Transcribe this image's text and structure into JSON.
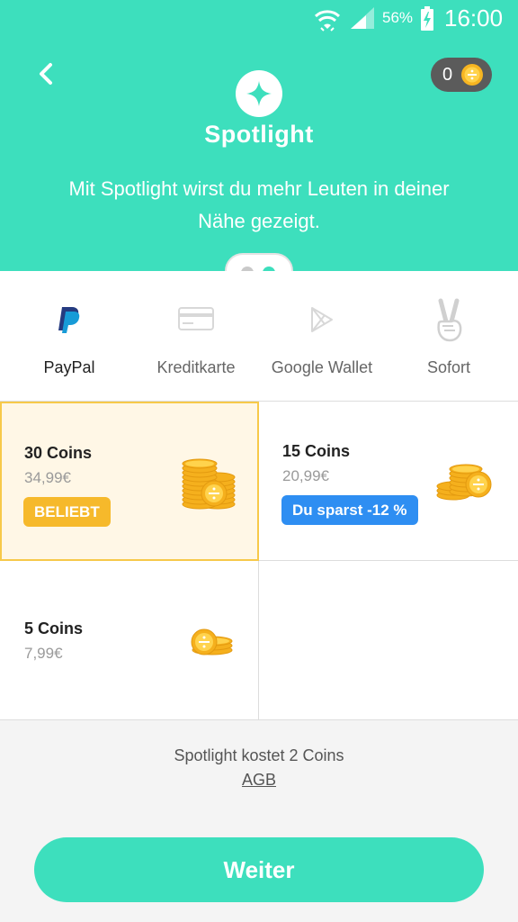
{
  "status": {
    "battery_pct": "56%",
    "time": "16:00"
  },
  "header": {
    "coin_count": "0",
    "title": "Spotlight",
    "description": "Mit Spotlight wirst du mehr Leuten in deiner Nähe gezeigt.",
    "accent_color": "#3ddfbd"
  },
  "pager": {
    "total": 2,
    "active": 2
  },
  "payment_methods": [
    {
      "label": "PayPal",
      "icon": "paypal-icon",
      "selected": true
    },
    {
      "label": "Kreditkarte",
      "icon": "credit-card-icon",
      "selected": false
    },
    {
      "label": "Google Wallet",
      "icon": "google-wallet-icon",
      "selected": false
    },
    {
      "label": "Sofort",
      "icon": "victory-hand-icon",
      "selected": false
    }
  ],
  "packages": [
    {
      "title": "30 Coins",
      "price": "34,99€",
      "badge": "BELIEBT",
      "selected": true
    },
    {
      "title": "15 Coins",
      "price": "20,99€",
      "badge": "Du sparst -12 %",
      "selected": false
    },
    {
      "title": "5 Coins",
      "price": "7,99€",
      "badge": "",
      "selected": false
    }
  ],
  "footer": {
    "cost_text": "Spotlight kostet 2 Coins",
    "agb_label": "AGB",
    "continue_label": "Weiter"
  }
}
